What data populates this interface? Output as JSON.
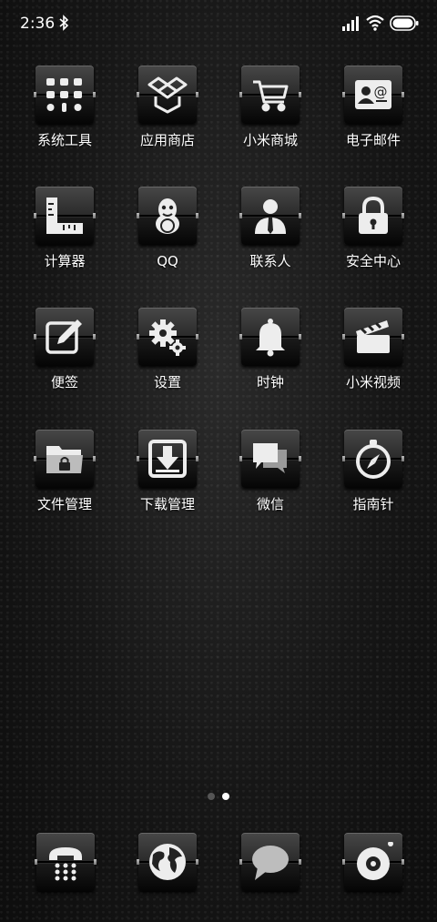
{
  "status_bar": {
    "time": "2:36",
    "icons": [
      "bluetooth-icon",
      "signal-icon",
      "wifi-icon",
      "battery-icon"
    ]
  },
  "apps": [
    {
      "label": "系统工具",
      "icon": "toolbox-icon"
    },
    {
      "label": "应用商店",
      "icon": "dropbox-icon"
    },
    {
      "label": "小米商城",
      "icon": "cart-icon"
    },
    {
      "label": "电子邮件",
      "icon": "contact-mail-icon"
    },
    {
      "label": "计算器",
      "icon": "ruler-icon"
    },
    {
      "label": "QQ",
      "icon": "penguin-icon"
    },
    {
      "label": "联系人",
      "icon": "person-icon"
    },
    {
      "label": "安全中心",
      "icon": "lock-icon"
    },
    {
      "label": "便签",
      "icon": "pencil-note-icon"
    },
    {
      "label": "设置",
      "icon": "gear-icon"
    },
    {
      "label": "时钟",
      "icon": "bell-icon"
    },
    {
      "label": "小米视频",
      "icon": "clapperboard-icon"
    },
    {
      "label": "文件管理",
      "icon": "folder-lock-icon"
    },
    {
      "label": "下载管理",
      "icon": "download-icon"
    },
    {
      "label": "微信",
      "icon": "chat-bubbles-icon"
    },
    {
      "label": "指南针",
      "icon": "compass-icon"
    }
  ],
  "pager": {
    "pages": 2,
    "active": 2
  },
  "dock": [
    {
      "name": "phone",
      "icon": "phone-icon"
    },
    {
      "name": "browser",
      "icon": "globe-icon"
    },
    {
      "name": "messages",
      "icon": "speech-bubble-icon"
    },
    {
      "name": "camera",
      "icon": "camera-lens-icon"
    }
  ],
  "colors": {
    "icon_glyph": "#ededed",
    "background": "#161616"
  }
}
